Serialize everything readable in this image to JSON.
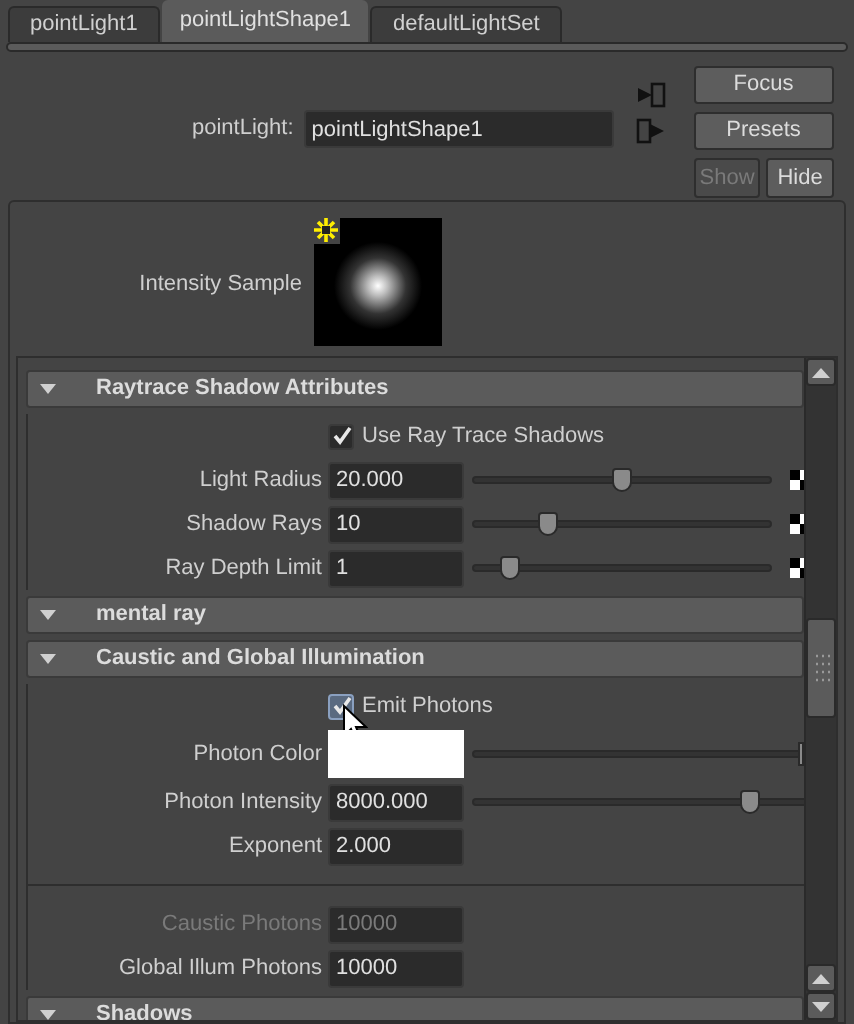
{
  "tabs": [
    {
      "label": "pointLight1",
      "selected": false
    },
    {
      "label": "pointLightShape1",
      "selected": true
    },
    {
      "label": "defaultLightSet",
      "selected": false
    }
  ],
  "node": {
    "label": "pointLight:",
    "value": "pointLightShape1"
  },
  "buttons": [
    {
      "label": "Focus",
      "disabled": false
    },
    {
      "label": "Presets",
      "disabled": false
    }
  ],
  "show_hide": [
    {
      "label": "Show",
      "disabled": true
    },
    {
      "label": "Hide",
      "disabled": false
    }
  ],
  "intensity_sample": {
    "label": "Intensity Sample"
  },
  "sections": [
    {
      "title": "Raytrace Shadow Attributes",
      "expanded": true,
      "rows": [
        {
          "kind": "checkbox",
          "label": "Use Ray Trace Shadows",
          "checked": true
        },
        {
          "kind": "slider",
          "label": "Light Radius",
          "value": "20.000",
          "level": 0.5,
          "map_button": true
        },
        {
          "kind": "slider",
          "label": "Shadow Rays",
          "value": "10",
          "level": 0.25,
          "map_button": true
        },
        {
          "kind": "slider",
          "label": "Ray Depth Limit",
          "value": "1",
          "level": 0.12,
          "map_button": true
        }
      ]
    },
    {
      "title": "mental ray",
      "expanded": true
    },
    {
      "title": "Caustic and Global Illumination",
      "expanded": true,
      "rows": [
        {
          "kind": "checkbox",
          "label": "Emit Photons",
          "checked": true,
          "cursor": true
        },
        {
          "kind": "color",
          "label": "Photon Color",
          "color": "#ffffff",
          "level": 1
        },
        {
          "kind": "slider",
          "label": "Photon Intensity",
          "value": "8000.000",
          "level": 0.8,
          "map_button": false
        },
        {
          "kind": "field",
          "label": "Exponent",
          "value": "2.000",
          "disabled": false
        },
        {
          "kind": "divider"
        },
        {
          "kind": "field",
          "label": "Caustic Photons",
          "value": "10000",
          "disabled": true
        },
        {
          "kind": "field",
          "label": "Global Illum Photons",
          "value": "10000",
          "disabled": false
        }
      ]
    },
    {
      "title": "Shadows",
      "expanded": true
    }
  ]
}
